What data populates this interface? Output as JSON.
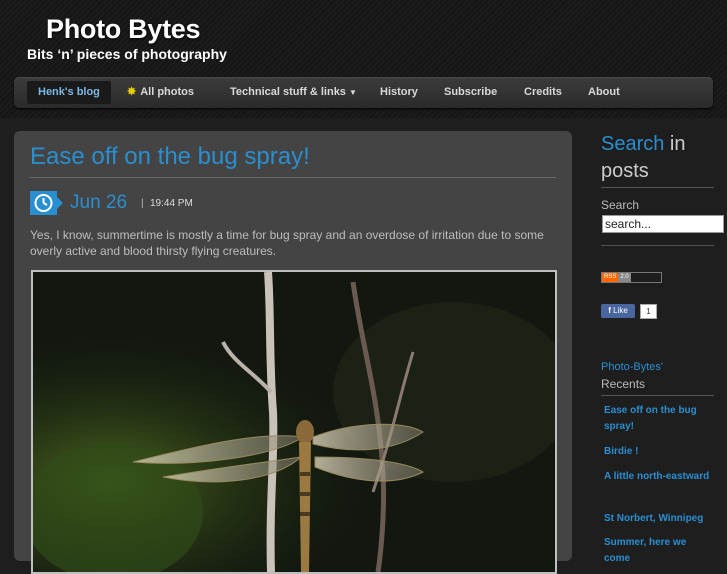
{
  "header": {
    "title": "Photo Bytes",
    "subtitle": "Bits ‘n’ pieces of photography"
  },
  "nav": {
    "items": [
      {
        "label": "Henk's blog",
        "active": true
      },
      {
        "label": "All photos",
        "icon": "star-icon"
      },
      {
        "label": "Technical stuff & links",
        "caret": true
      },
      {
        "label": "History"
      },
      {
        "label": "Subscribe"
      },
      {
        "label": "Credits"
      },
      {
        "label": "About"
      }
    ]
  },
  "post": {
    "title": "Ease off on the bug spray!",
    "date": "Jun 26",
    "separator": "|",
    "time": "19:44 PM",
    "text": "Yes, I know, summertime is mostly a time for bug spray and an overdose of irritation due to some overly active and blood thirsty flying creatures."
  },
  "sidebar": {
    "search_heading_blue": "Search",
    "search_heading_rest": " in posts",
    "search_label": "Search",
    "search_placeholder": "search...",
    "rss_left": "RSS",
    "rss_right": "2.0",
    "fb_like": "Like",
    "fb_count": "1",
    "recents_title_a": "Photo-Bytes'",
    "recents_title_b": "Recents",
    "recents": [
      "Ease off on the bug spray!",
      "Birdie !",
      "A little north-eastward",
      "St Norbert, Winnipeg",
      "Summer, here we come"
    ]
  },
  "colors": {
    "accent": "#2a8fd0",
    "background": "#1e1e1e",
    "panel": "#444444"
  }
}
